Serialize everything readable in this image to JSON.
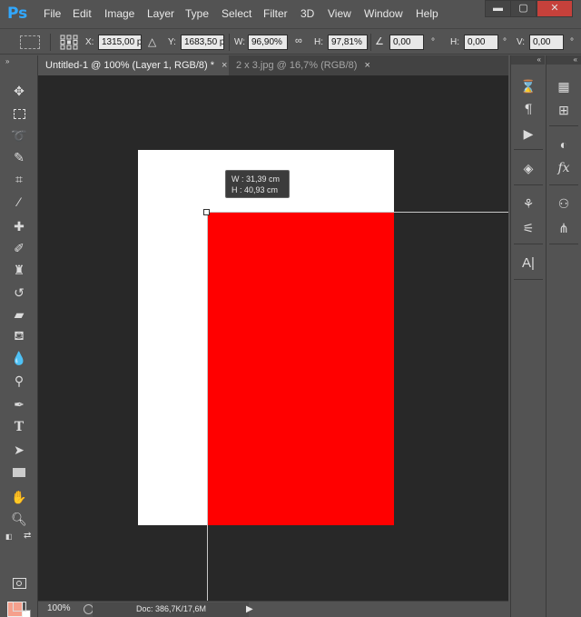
{
  "app": {
    "logo": "Ps"
  },
  "menu": [
    "File",
    "Edit",
    "Image",
    "Layer",
    "Type",
    "Select",
    "Filter",
    "3D",
    "View",
    "Window",
    "Help"
  ],
  "window_controls": {
    "minimize": "▬",
    "maximize": "▢",
    "close": "✕"
  },
  "options": {
    "x_label": "X:",
    "x_value": "1315,00 p",
    "y_label": "Y:",
    "y_value": "1683,50 p",
    "w_label": "W:",
    "w_value": "96,90%",
    "h_label": "H:",
    "h_value": "97,81%",
    "angle_value": "0,00",
    "angle_unit": "°",
    "hskew_label": "H:",
    "hskew_value": "0,00",
    "hskew_unit": "°",
    "vskew_label": "V:",
    "vskew_value": "0,00",
    "vskew_unit": "°"
  },
  "tabs": [
    {
      "label": "Untitled-1 @ 100% (Layer 1, RGB/8) *",
      "close": "×"
    },
    {
      "label": "2 x 3.jpg @ 16,7% (RGB/8)",
      "close": "×"
    }
  ],
  "canvas": {
    "tooltip_w": "W :   31,39 cm",
    "tooltip_h": "H :   40,93 cm"
  },
  "status": {
    "zoom": "100%",
    "doc": "Doc: 386,7K/17,6M",
    "arrow": "▶"
  },
  "colors": {
    "foreground": "#f5a08d",
    "background": "#ffffff",
    "layer_fill": "#ff0000"
  },
  "icons": {
    "collapse_left": "»",
    "collapse_right": "«"
  }
}
